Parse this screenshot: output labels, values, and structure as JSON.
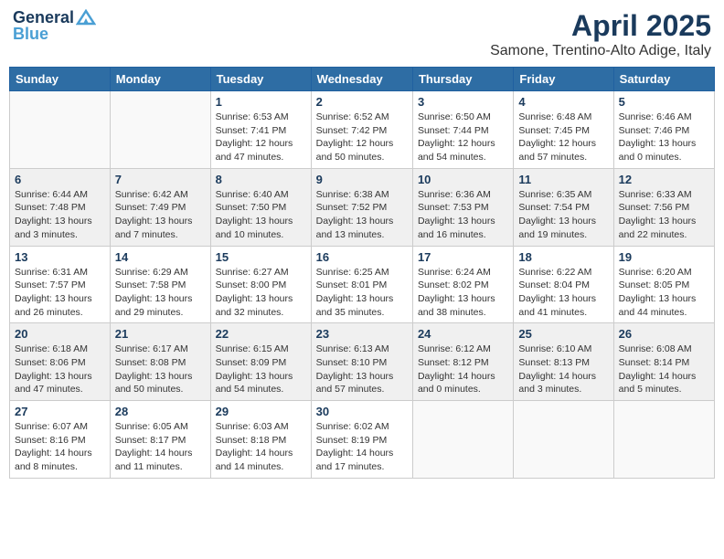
{
  "header": {
    "logo_line1": "General",
    "logo_line2": "Blue",
    "month_title": "April 2025",
    "location": "Samone, Trentino-Alto Adige, Italy"
  },
  "days_of_week": [
    "Sunday",
    "Monday",
    "Tuesday",
    "Wednesday",
    "Thursday",
    "Friday",
    "Saturday"
  ],
  "weeks": [
    [
      {
        "day": "",
        "info": ""
      },
      {
        "day": "",
        "info": ""
      },
      {
        "day": "1",
        "info": "Sunrise: 6:53 AM\nSunset: 7:41 PM\nDaylight: 12 hours\nand 47 minutes."
      },
      {
        "day": "2",
        "info": "Sunrise: 6:52 AM\nSunset: 7:42 PM\nDaylight: 12 hours\nand 50 minutes."
      },
      {
        "day": "3",
        "info": "Sunrise: 6:50 AM\nSunset: 7:44 PM\nDaylight: 12 hours\nand 54 minutes."
      },
      {
        "day": "4",
        "info": "Sunrise: 6:48 AM\nSunset: 7:45 PM\nDaylight: 12 hours\nand 57 minutes."
      },
      {
        "day": "5",
        "info": "Sunrise: 6:46 AM\nSunset: 7:46 PM\nDaylight: 13 hours\nand 0 minutes."
      }
    ],
    [
      {
        "day": "6",
        "info": "Sunrise: 6:44 AM\nSunset: 7:48 PM\nDaylight: 13 hours\nand 3 minutes."
      },
      {
        "day": "7",
        "info": "Sunrise: 6:42 AM\nSunset: 7:49 PM\nDaylight: 13 hours\nand 7 minutes."
      },
      {
        "day": "8",
        "info": "Sunrise: 6:40 AM\nSunset: 7:50 PM\nDaylight: 13 hours\nand 10 minutes."
      },
      {
        "day": "9",
        "info": "Sunrise: 6:38 AM\nSunset: 7:52 PM\nDaylight: 13 hours\nand 13 minutes."
      },
      {
        "day": "10",
        "info": "Sunrise: 6:36 AM\nSunset: 7:53 PM\nDaylight: 13 hours\nand 16 minutes."
      },
      {
        "day": "11",
        "info": "Sunrise: 6:35 AM\nSunset: 7:54 PM\nDaylight: 13 hours\nand 19 minutes."
      },
      {
        "day": "12",
        "info": "Sunrise: 6:33 AM\nSunset: 7:56 PM\nDaylight: 13 hours\nand 22 minutes."
      }
    ],
    [
      {
        "day": "13",
        "info": "Sunrise: 6:31 AM\nSunset: 7:57 PM\nDaylight: 13 hours\nand 26 minutes."
      },
      {
        "day": "14",
        "info": "Sunrise: 6:29 AM\nSunset: 7:58 PM\nDaylight: 13 hours\nand 29 minutes."
      },
      {
        "day": "15",
        "info": "Sunrise: 6:27 AM\nSunset: 8:00 PM\nDaylight: 13 hours\nand 32 minutes."
      },
      {
        "day": "16",
        "info": "Sunrise: 6:25 AM\nSunset: 8:01 PM\nDaylight: 13 hours\nand 35 minutes."
      },
      {
        "day": "17",
        "info": "Sunrise: 6:24 AM\nSunset: 8:02 PM\nDaylight: 13 hours\nand 38 minutes."
      },
      {
        "day": "18",
        "info": "Sunrise: 6:22 AM\nSunset: 8:04 PM\nDaylight: 13 hours\nand 41 minutes."
      },
      {
        "day": "19",
        "info": "Sunrise: 6:20 AM\nSunset: 8:05 PM\nDaylight: 13 hours\nand 44 minutes."
      }
    ],
    [
      {
        "day": "20",
        "info": "Sunrise: 6:18 AM\nSunset: 8:06 PM\nDaylight: 13 hours\nand 47 minutes."
      },
      {
        "day": "21",
        "info": "Sunrise: 6:17 AM\nSunset: 8:08 PM\nDaylight: 13 hours\nand 50 minutes."
      },
      {
        "day": "22",
        "info": "Sunrise: 6:15 AM\nSunset: 8:09 PM\nDaylight: 13 hours\nand 54 minutes."
      },
      {
        "day": "23",
        "info": "Sunrise: 6:13 AM\nSunset: 8:10 PM\nDaylight: 13 hours\nand 57 minutes."
      },
      {
        "day": "24",
        "info": "Sunrise: 6:12 AM\nSunset: 8:12 PM\nDaylight: 14 hours\nand 0 minutes."
      },
      {
        "day": "25",
        "info": "Sunrise: 6:10 AM\nSunset: 8:13 PM\nDaylight: 14 hours\nand 3 minutes."
      },
      {
        "day": "26",
        "info": "Sunrise: 6:08 AM\nSunset: 8:14 PM\nDaylight: 14 hours\nand 5 minutes."
      }
    ],
    [
      {
        "day": "27",
        "info": "Sunrise: 6:07 AM\nSunset: 8:16 PM\nDaylight: 14 hours\nand 8 minutes."
      },
      {
        "day": "28",
        "info": "Sunrise: 6:05 AM\nSunset: 8:17 PM\nDaylight: 14 hours\nand 11 minutes."
      },
      {
        "day": "29",
        "info": "Sunrise: 6:03 AM\nSunset: 8:18 PM\nDaylight: 14 hours\nand 14 minutes."
      },
      {
        "day": "30",
        "info": "Sunrise: 6:02 AM\nSunset: 8:19 PM\nDaylight: 14 hours\nand 17 minutes."
      },
      {
        "day": "",
        "info": ""
      },
      {
        "day": "",
        "info": ""
      },
      {
        "day": "",
        "info": ""
      }
    ]
  ]
}
